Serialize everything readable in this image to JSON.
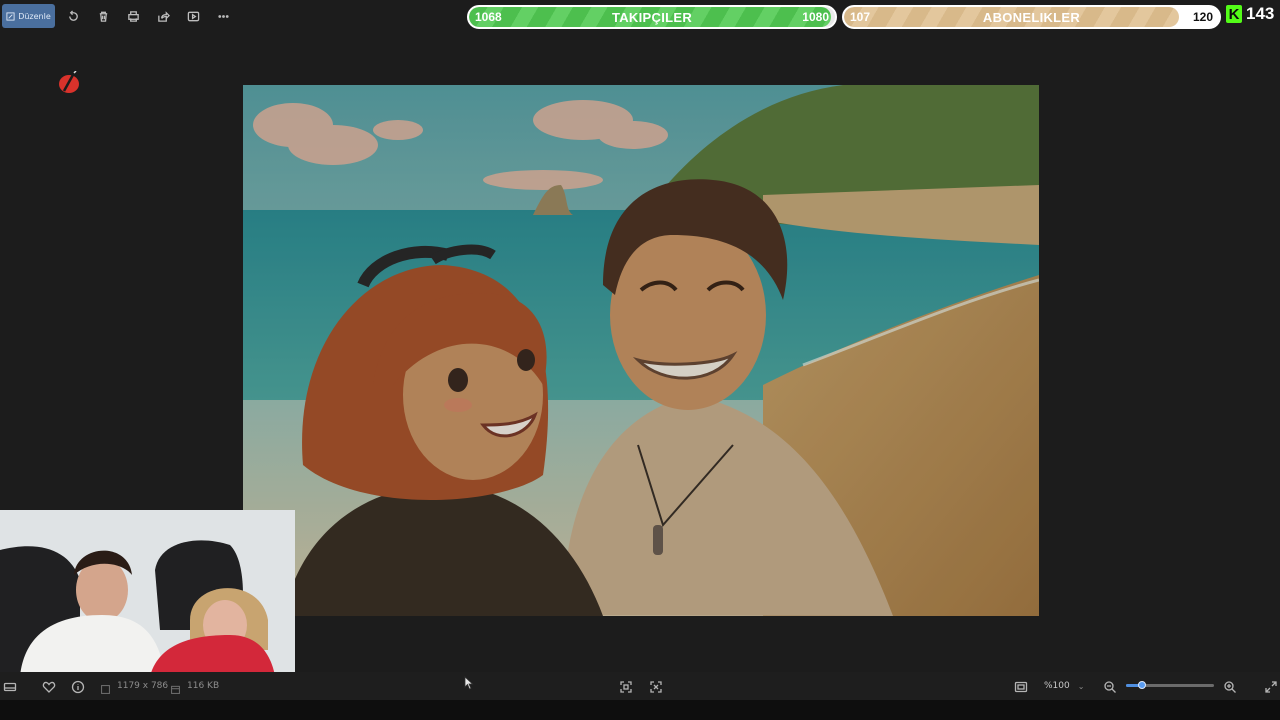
{
  "toolbar": {
    "edit_label": "Düzenle",
    "icons": [
      "rotate-icon",
      "trash-icon",
      "print-icon",
      "share-icon",
      "slideshow-icon",
      "more-icon"
    ]
  },
  "overlay": {
    "followers": {
      "current": "1068",
      "label": "TAKIPÇILER",
      "goal": "1080",
      "progress": 0.989
    },
    "subscriptions": {
      "current": "107",
      "label": "ABONELIKLER",
      "goal": "120",
      "progress": 0.892
    },
    "kick": {
      "logo": "K",
      "count": "143"
    }
  },
  "colors": {
    "followers_bar": "#4dbf4e",
    "subs_bar": "#d8b98a",
    "kick_green": "#53fc18",
    "accent": "#4a6f9e"
  },
  "statusbar": {
    "dimensions": "1179 x 786",
    "file_size": "116 KB",
    "zoom": "%100",
    "zoom_progress": 0.18
  }
}
